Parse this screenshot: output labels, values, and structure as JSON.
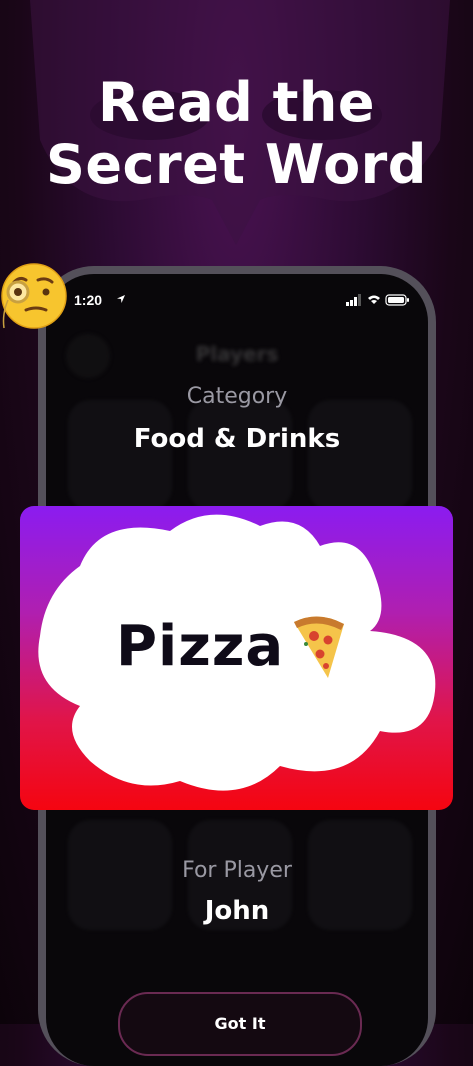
{
  "headline": {
    "line1": "Read the",
    "line2": "Secret Word"
  },
  "status_bar": {
    "time": "1:20"
  },
  "phone_screen": {
    "blurred_title": "Players",
    "category_label": "Category",
    "category_value": "Food & Drinks",
    "player_label": "For Player",
    "player_value": "John",
    "confirm_button": "Got It"
  },
  "secret_card": {
    "word": "Pizza",
    "emoji_icon": "pizza-icon"
  },
  "colors": {
    "card_top": "#8b1cf0",
    "card_bottom": "#f50510",
    "background": "#2b0b31"
  }
}
